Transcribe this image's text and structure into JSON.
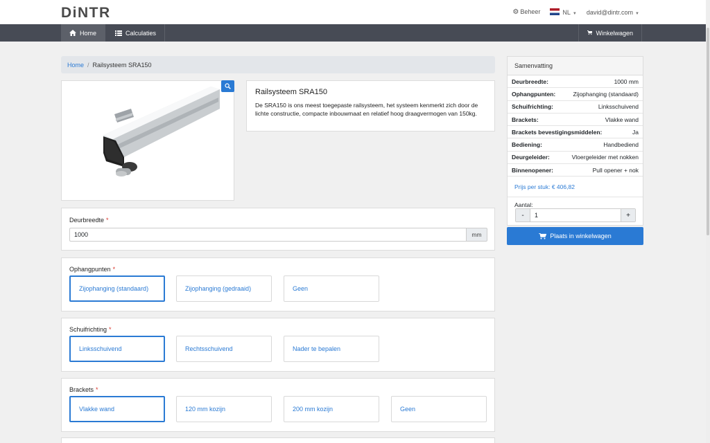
{
  "brand": {
    "logo": "DiNTR"
  },
  "topbar": {
    "admin": "Beheer",
    "language": "NL",
    "user": "david@dintr.com"
  },
  "nav": {
    "home": "Home",
    "calculations": "Calculaties",
    "cart": "Winkelwagen"
  },
  "breadcrumb": {
    "home": "Home",
    "current": "Railsysteem SRA150"
  },
  "product": {
    "title": "Railsysteem SRA150",
    "description": "De SRA150 is ons meest toegepaste railsysteem, het systeem kenmerkt zich door de lichte constructie, compacte inbouwmaat en relatief hoog draagvermogen van 150kg."
  },
  "summary": {
    "title": "Samenvatting",
    "rows": [
      {
        "key": "Deurbreedte:",
        "value": "1000 mm"
      },
      {
        "key": "Ophangpunten:",
        "value": "Zijophanging (standaard)"
      },
      {
        "key": "Schuifrichting:",
        "value": "Linksschuivend"
      },
      {
        "key": "Brackets:",
        "value": "Vlakke wand"
      },
      {
        "key": "Brackets bevestigingsmiddelen:",
        "value": "Ja"
      },
      {
        "key": "Bediening:",
        "value": "Handbediend"
      },
      {
        "key": "Deurgeleider:",
        "value": "Vloergeleider met nokken"
      },
      {
        "key": "Binnenopener:",
        "value": "Pull opener + nok"
      }
    ],
    "price": "Prijs per stuk: € 406,82",
    "quantity_label": "Aantal:",
    "quantity": "1",
    "minus": "-",
    "plus": "+",
    "add_to_cart": "Plaats in winkelwagen"
  },
  "form": {
    "width": {
      "label": "Deurbreedte",
      "required": "*",
      "value": "1000",
      "unit": "mm"
    },
    "suspension": {
      "label": "Ophangpunten",
      "required": "*",
      "options": [
        "Zijophanging (standaard)",
        "Zijophanging (gedraaid)",
        "Geen"
      ]
    },
    "direction": {
      "label": "Schuifrichting",
      "required": "*",
      "options": [
        "Linksschuivend",
        "Rechtsschuivend",
        "Nader te bepalen"
      ]
    },
    "brackets": {
      "label": "Brackets",
      "required": "*",
      "options": [
        "Vlakke wand",
        "120 mm kozijn",
        "200 mm kozijn",
        "Geen"
      ]
    }
  },
  "colors": {
    "accent": "#2a7ad4",
    "navbar": "#474b55",
    "required": "#d9342b"
  }
}
